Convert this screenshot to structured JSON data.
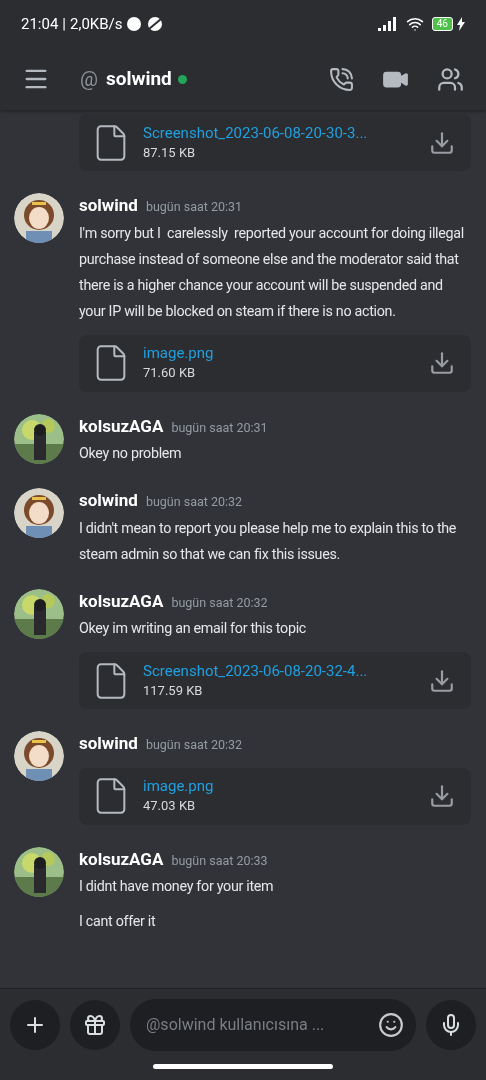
{
  "status_bar": {
    "time": "21:04",
    "separator": "|",
    "speed": "2,0KB/s",
    "battery": "46"
  },
  "header": {
    "prefix": "@",
    "name": "solwind",
    "online": true
  },
  "leading_attachment": {
    "filename": "Screenshot_2023-06-08-20-30-3...",
    "size": "87.15 KB"
  },
  "messages": [
    {
      "author": "solwind",
      "time": "bugün saat 20:31",
      "lines": [
        "I'm sorry but I  carelessly  reported your account for doing illegal purchase instead of someone else and the moderator said that there is a higher chance your account will be suspended and your IP will be blocked on steam if there is no action."
      ],
      "attachments": [
        {
          "filename": "image.png",
          "size": "71.60 KB"
        }
      ]
    },
    {
      "author": "kolsuzAGA",
      "time": "bugün saat 20:31",
      "lines": [
        "Okey no problem"
      ]
    },
    {
      "author": "solwind",
      "time": "bugün saat 20:32",
      "lines": [
        "I didn't mean to report you please help me to explain this to the steam admin so that we can fix this issues."
      ]
    },
    {
      "author": "kolsuzAGA",
      "time": "bugün saat 20:32",
      "lines": [
        "Okey im writing an email for this topic"
      ],
      "attachments": [
        {
          "filename": "Screenshot_2023-06-08-20-32-4...",
          "size": "117.59 KB"
        }
      ]
    },
    {
      "author": "solwind",
      "time": "bugün saat 20:32",
      "attachments": [
        {
          "filename": "image.png",
          "size": "47.03 KB"
        }
      ]
    },
    {
      "author": "kolsuzAGA",
      "time": "bugün saat 20:33",
      "lines": [
        "I didnt have money for your item",
        "I cant offer it"
      ]
    }
  ],
  "composer": {
    "placeholder": "@solwind kullanıcısına ..."
  }
}
